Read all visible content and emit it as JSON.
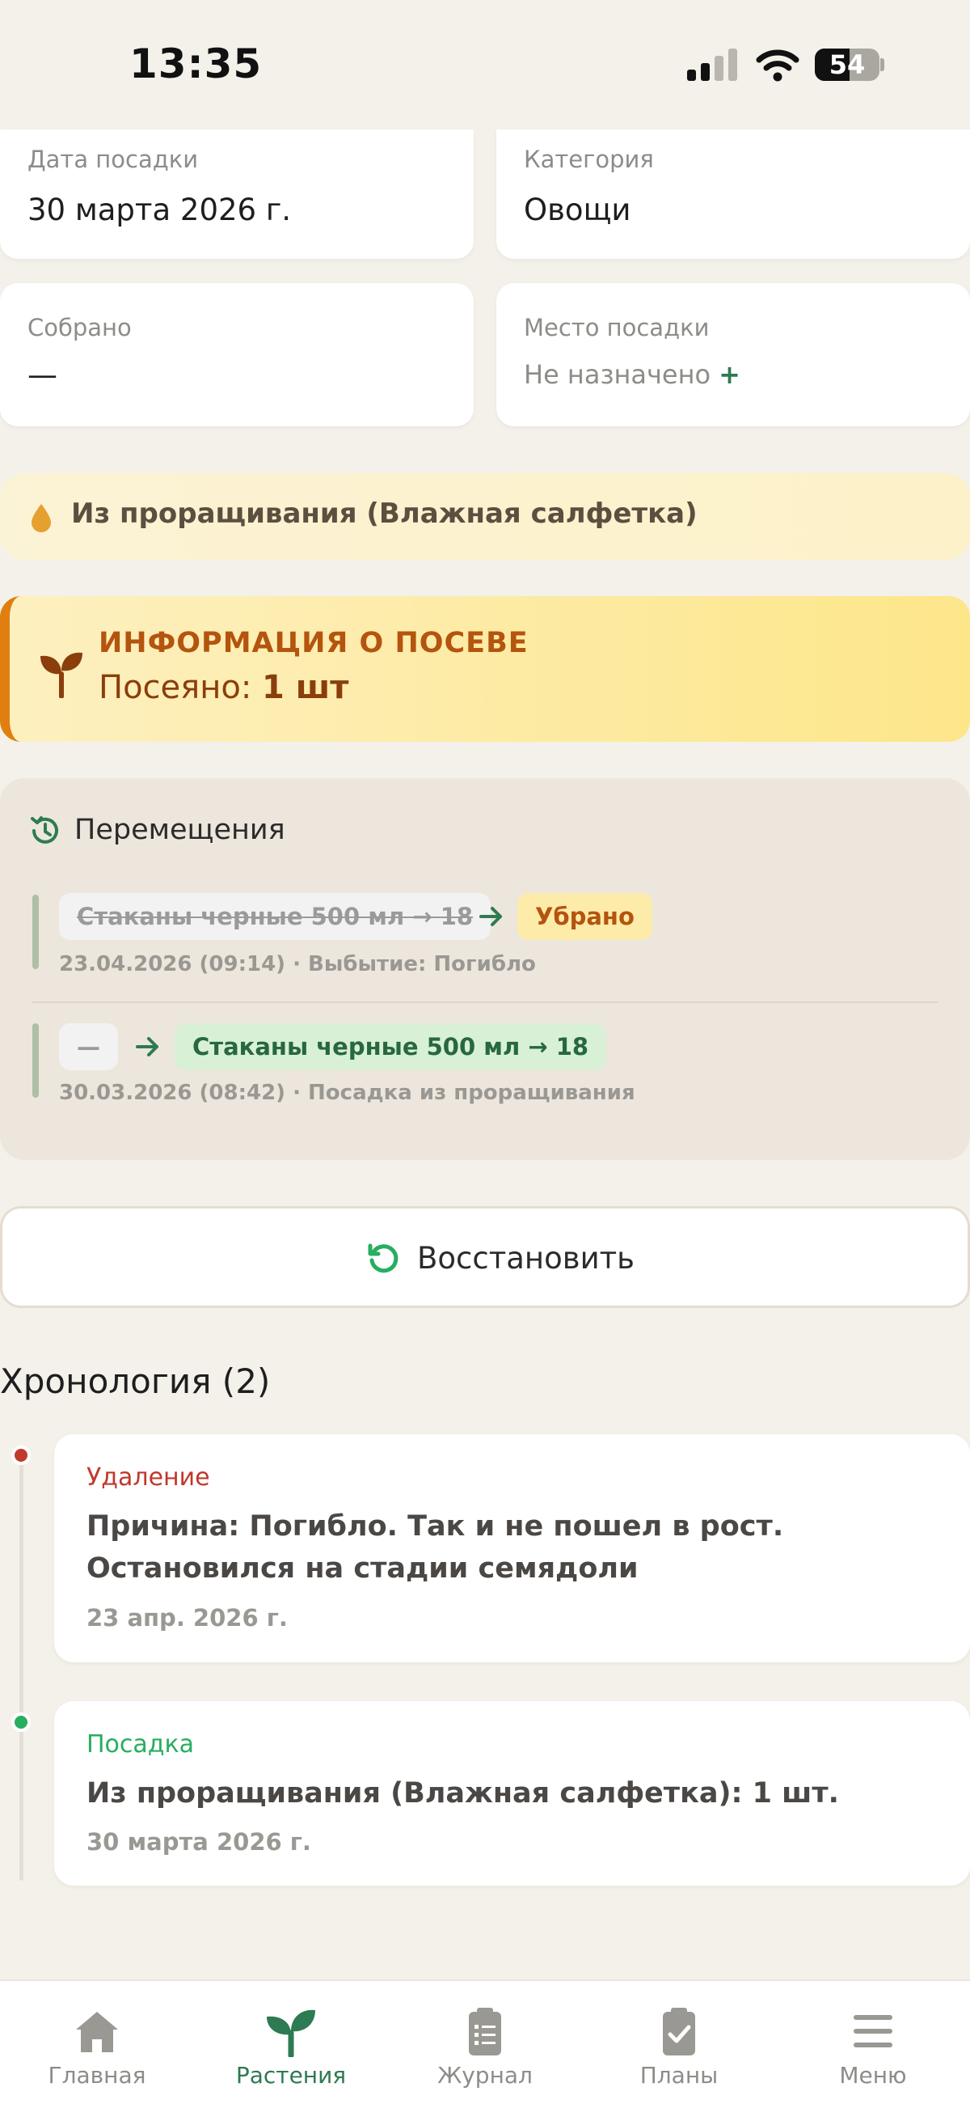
{
  "status_bar": {
    "time": "13:35",
    "battery": "54"
  },
  "info_cards": {
    "planting_date": {
      "label": "Дата посадки",
      "value": "30 марта 2026 г."
    },
    "category": {
      "label": "Категория",
      "value": "Овощи"
    },
    "harvested": {
      "label": "Собрано",
      "value": "—"
    },
    "location": {
      "label": "Место посадки",
      "value": "Не назначено",
      "add": "+"
    }
  },
  "source_banner": {
    "text": "Из проращивания (Влажная салфетка)"
  },
  "sowing_info": {
    "title": "ИНФОРМАЦИЯ О ПОСЕВЕ",
    "label": "Посеяно:",
    "value": "1 шт"
  },
  "movements": {
    "title": "Перемещения",
    "items": [
      {
        "from": "Стаканы черные 500 мл → 18",
        "to": "Убрано",
        "meta": "23.04.2026 (09:14) · Выбытие: Погибло"
      },
      {
        "from": "—",
        "to": "Стаканы черные 500 мл → 18",
        "meta": "30.03.2026 (08:42) · Посадка из проращивания"
      }
    ]
  },
  "restore_button": {
    "label": "Восстановить"
  },
  "timeline": {
    "title": "Хронология (2)",
    "events": [
      {
        "type": "Удаление",
        "text": "Причина: Погибло. Так и не пошел в рост. Остановился на стадии семядоли",
        "date": "23 апр. 2026 г."
      },
      {
        "type": "Посадка",
        "text": "Из проращивания (Влажная салфетка): 1 шт.",
        "date": "30 марта 2026 г."
      }
    ]
  },
  "tabbar": {
    "items": [
      {
        "label": "Главная",
        "icon": "home-icon"
      },
      {
        "label": "Растения",
        "icon": "sprout-icon"
      },
      {
        "label": "Журнал",
        "icon": "clipboard-list-icon"
      },
      {
        "label": "Планы",
        "icon": "clipboard-check-icon"
      },
      {
        "label": "Меню",
        "icon": "menu-icon"
      }
    ],
    "active": "Растения"
  },
  "colors": {
    "accent_green": "#2e7a52",
    "delete_red": "#c0392b",
    "plant_green": "#27ae60",
    "sow_orange": "#b4540e"
  }
}
